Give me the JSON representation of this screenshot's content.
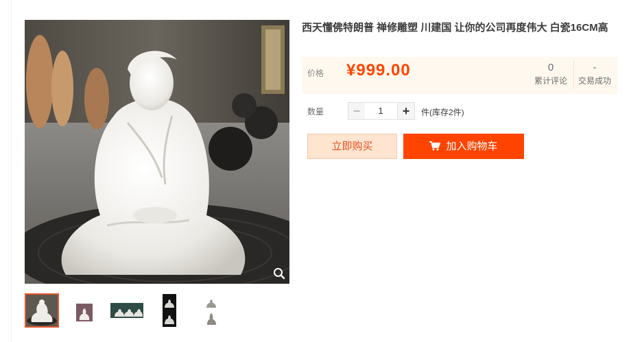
{
  "product": {
    "title": "西天懂佛特朗普 禅修雕塑 川建国 让你的公司再度伟大 白瓷16CM高"
  },
  "gallery": {
    "main_image_alt": "White porcelain seated meditation figure",
    "thumbnail_count": 5,
    "active_thumbnail_index": 0
  },
  "price": {
    "label": "价格",
    "value": "¥999.00"
  },
  "stats": {
    "reviews_count": "0",
    "reviews_label": "累计评论",
    "sales_count": "-",
    "sales_label": "交易成功"
  },
  "quantity": {
    "label": "数量",
    "value": "1",
    "decrement": "−",
    "increment": "+",
    "stock_note": "件(库存2件)"
  },
  "actions": {
    "buy_now_label": "立即购买",
    "add_to_cart_label": "加入购物车"
  },
  "colors": {
    "accent": "#ff4400",
    "buy_now_bg": "#ffe4d0",
    "price_box_bg": "#fff8ef"
  }
}
